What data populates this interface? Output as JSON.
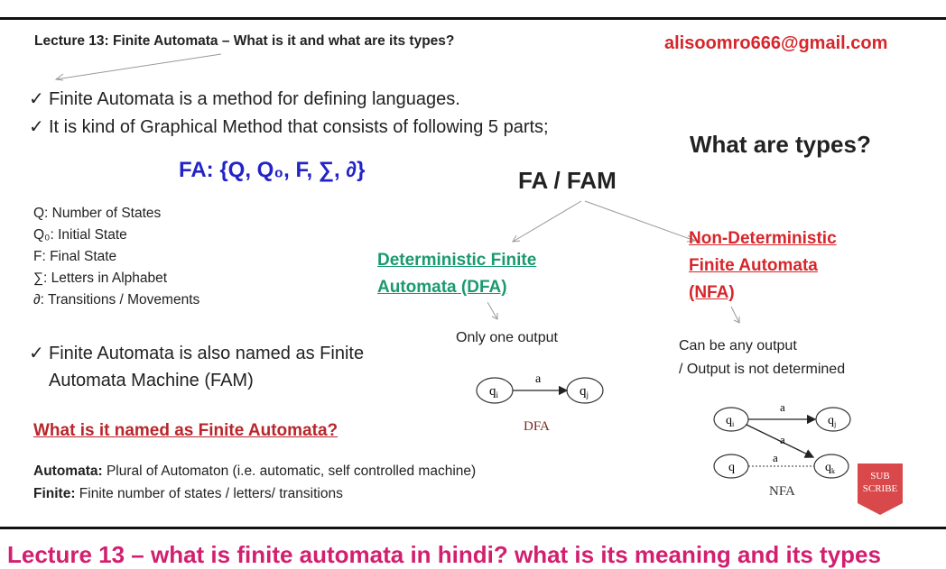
{
  "header": {
    "lecture_title": "Lecture 13: Finite Automata – What is it and what are its types?",
    "email": "alisoomro666@gmail.com"
  },
  "bullets": {
    "check_mark": "✓",
    "b1": "Finite Automata is a method for defining languages.",
    "b2": "It is kind of Graphical Method that consists of following 5 parts;",
    "b3_line1": "Finite Automata is also named as Finite",
    "b3_line2": "Automata Machine (FAM)"
  },
  "fa_definition": "FA: {Q, Q₀, F, ∑, ∂}",
  "legend": [
    "Q: Number of States",
    "Q₀: Initial State",
    "F: Final State",
    "∑: Letters in Alphabet",
    "∂: Transitions / Movements"
  ],
  "types": {
    "title": "What are types?",
    "root": "FA / FAM",
    "dfa_heading_l1": "Deterministic Finite",
    "dfa_heading_l2": "Automata (DFA)",
    "nfa_heading_l1": "Non-Deterministic",
    "nfa_heading_l2": "Finite Automata",
    "nfa_heading_l3": "(NFA)",
    "dfa_output": "Only one output",
    "nfa_output_l1": "Can be any output",
    "nfa_output_l2": "/ Output is not determined"
  },
  "dfa_diagram": {
    "state_from": "q",
    "state_from_sub": "i",
    "state_to": "q",
    "state_to_sub": "j",
    "symbol": "a",
    "caption": "DFA"
  },
  "nfa_diagram": {
    "q": "q",
    "qi_sub": "i",
    "qj_sub": "j",
    "qk_sub": "k",
    "symbol": "a",
    "caption": "NFA"
  },
  "naming": {
    "question": "What is it named as Finite Automata?",
    "automata_term": "Automata:",
    "automata_def": " Plural of Automaton (i.e. automatic,  self controlled machine)",
    "finite_term": "Finite:",
    "finite_def": " Finite number of states / letters/ transitions"
  },
  "subscribe": {
    "line1": "SUB",
    "line2": "SCRIBE"
  },
  "bottom_caption": "Lecture 13 – what is finite automata in hindi? what is its meaning and its types"
}
